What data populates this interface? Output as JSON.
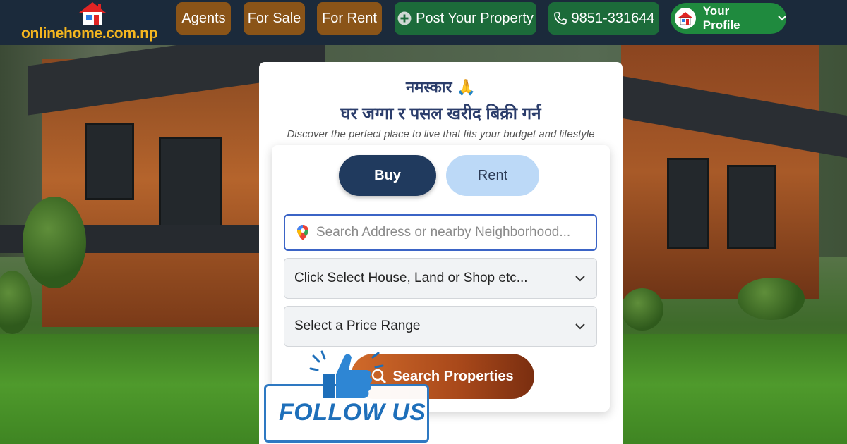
{
  "header": {
    "logo_text": "onlinehome.com.np",
    "nav": {
      "agents": "Agents",
      "for_sale": "For Sale",
      "for_rent": "For Rent",
      "post_property": "Post Your Property",
      "phone": "9851-331644",
      "profile": "Your Profile"
    },
    "icons": {
      "logo": "house-logo-icon",
      "post": "plus-circle-icon",
      "phone": "phone-icon",
      "profile": "house-avatar-icon",
      "profile_menu": "chevron-down-icon"
    }
  },
  "card": {
    "greeting": "नमस्कार 🙏",
    "title": "घर जग्गा र पसल खरीद बिक्री गर्न",
    "subtitle": "Discover the perfect place to live that fits your budget and lifestyle",
    "tabs": {
      "buy": "Buy",
      "rent": "Rent",
      "selected": "Buy"
    },
    "search": {
      "placeholder": "Search Address or nearby Neighborhood...",
      "value": "",
      "icon": "map-pin-icon"
    },
    "property_type_select": "Click Select House, Land or Shop etc...",
    "price_range_select": "Select a Price Range",
    "search_button": "Search Properties"
  },
  "overlay": {
    "follow_text": "FOLLOW US",
    "icon": "thumbs-up-icon"
  },
  "colors": {
    "header_bg": "#1b2a3b",
    "logo_text": "#f5b61f",
    "nav_brown": "#8a5418",
    "nav_green": "#1c6b3a",
    "profile_green": "#1f8a3e",
    "buy_tab": "#203a5e",
    "rent_tab": "#bcd9f7",
    "search_border": "#3b64c6",
    "search_button": "#b4501e",
    "follow_blue": "#1e6fba"
  }
}
